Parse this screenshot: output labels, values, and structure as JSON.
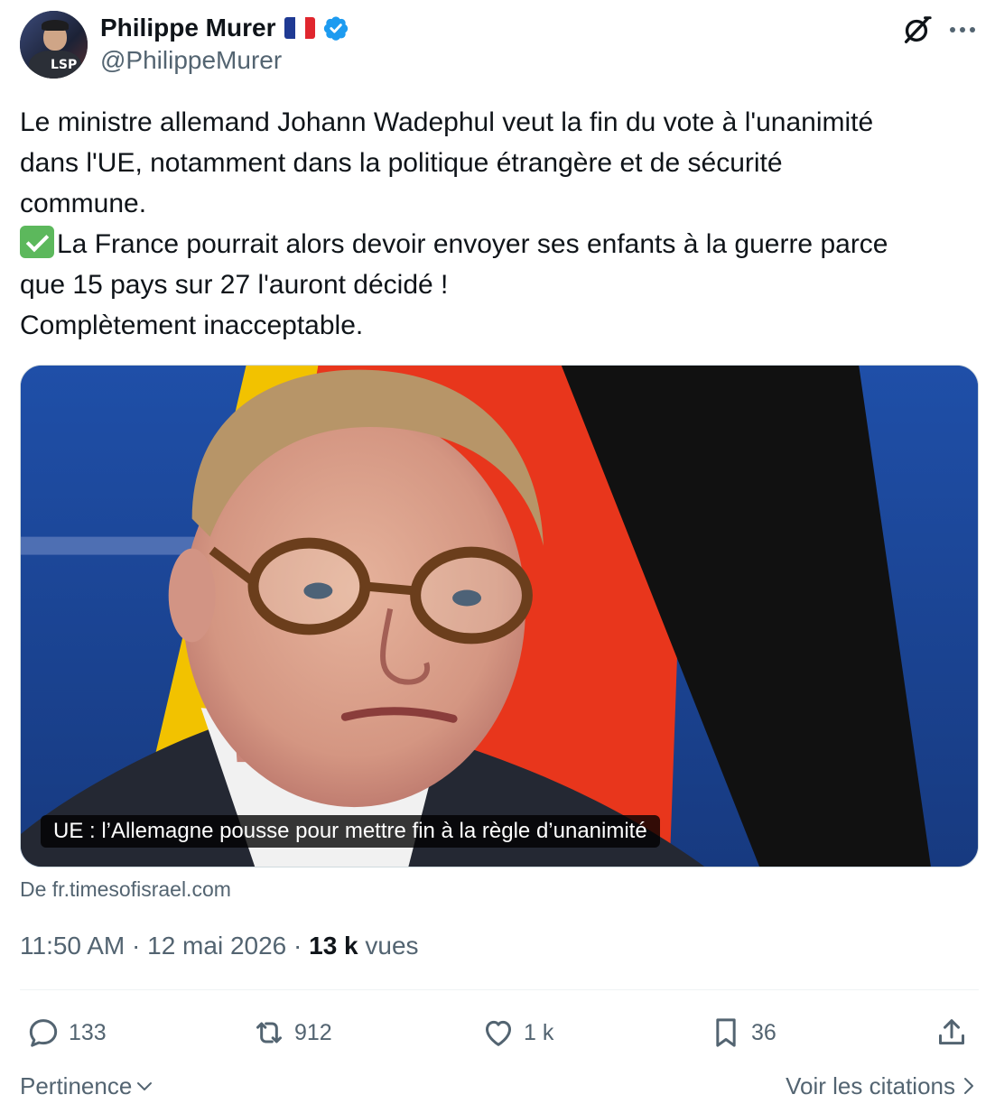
{
  "author": {
    "display_name": "Philippe Murer",
    "handle": "@PhilippeMurer",
    "flag_icon": "france-flag-icon",
    "verified_icon": "verified-badge-icon",
    "avatar_tag": "LSP"
  },
  "header_icons": [
    "grok-icon",
    "more-options-icon"
  ],
  "tweet": {
    "lines": [
      "Le ministre allemand Johann Wadephul veut la fin du vote à l'unanimité",
      "dans l'UE, notamment dans la politique étrangère et de sécurité",
      "commune.",
      "La France pourrait alors devoir envoyer ses enfants à la guerre parce",
      "que 15 pays sur 27 l'auront décidé !",
      "Complètement inacceptable."
    ]
  },
  "card": {
    "caption": "UE : l’Allemagne pousse pour mettre fin à la règle d’unanimité",
    "source": "De fr.timesofisrael.com"
  },
  "meta": {
    "time": "11:50 AM",
    "separator": "·",
    "date": "12 mai 2026",
    "views_count": "13 k",
    "views_label": "vues"
  },
  "actions": {
    "replies": "133",
    "reposts": "912",
    "likes": "1 k",
    "bookmarks": "36"
  },
  "footer": {
    "sort_label": "Pertinence",
    "citations_label": "Voir les citations"
  },
  "colors": {
    "text": "#0f1419",
    "secondary": "#536471",
    "verified": "#1d9bf0",
    "divider": "#eff3f4"
  }
}
